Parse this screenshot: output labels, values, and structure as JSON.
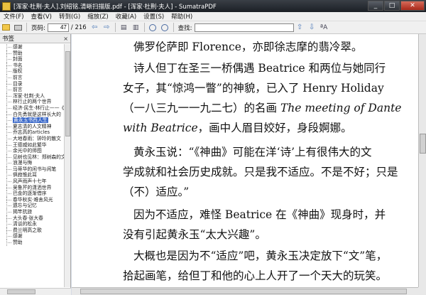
{
  "window": {
    "title": "[浑家·杜荆·夫人].刘绍铭.清晰扫描版.pdf - [浑家·杜荆·夫人] - SumatraPDF",
    "min": "_",
    "max": "□",
    "close": "✕"
  },
  "menu": [
    "文件(F)",
    "查看(V)",
    "转到(G)",
    "缩放(Z)",
    "收藏(A)",
    "设置(S)",
    "帮助(H)"
  ],
  "toolbar": {
    "page_label": "页码:",
    "page_value": "47",
    "page_total": "/ 216",
    "find_label": "查找:",
    "find_value": "",
    "case_label": "ªA"
  },
  "sidebar": {
    "title": "书签",
    "close": "×",
    "items": [
      "感谢",
      "赞助",
      "封面",
      "书名",
      "版权",
      "前言",
      "目录",
      "前言",
      "浑家·杜荆·夫人",
      "林行止的两个世界",
      "经济·民生·林行止——《",
      "白先勇就是这样长大的",
      "黄永玉书西人生",
      "夏志清的人文精神",
      "乔志高的articles",
      "大地春雨：钟玲的散文",
      "王德威如此繁华",
      "余光中的师图",
      "见树也见林：郑树森的文",
      "浪漫与悔",
      "马蒂华的闲书与闲笔",
      "俱寂惟此耳",
      "风声雨声十七年",
      "吴鲁芹的潇洒世界",
      "巴金的逐渐借序",
      "春华秋实·难舍风光",
      "遗忘与记忆",
      "揭竿抗旅",
      "大头春·张大春",
      "清谈的松永",
      "费兰明高之歌",
      "感谢",
      "赞助"
    ],
    "selected_index": 12
  },
  "document": {
    "paragraphs": [
      [
        "佛罗伦萨即 Florence，亦即徐志摩的翡冷翠。"
      ],
      [
        "诗人但丁在圣三一桥偶遇 Beatrice 和两位与她同行"
      ],
      [
        "女子，其“惊鸿一瞥”的神貌，已入了 Henry Holiday"
      ],
      [
        "（一八三九一一九二七）的名画 ",
        "The meeting of Dante",
        ""
      ],
      [
        "",
        "with Beatrice",
        "，画中人眉目姣好，身段婀娜。"
      ],
      [
        "黄永玉说：“《神曲》可能在洋‘诗’上有很伟大的文"
      ],
      [
        "学成就和社会历史成就。只是我不适应。不是不好；只是"
      ],
      [
        "（不）适应。”"
      ],
      [
        "因为不适应，难怪 Beatrice 在《神曲》现身时，并"
      ],
      [
        "没有引起黄永玉“太大兴趣”。"
      ],
      [
        "大概也是因为不“适应”吧，黄永玉决定放下“文”笔，"
      ],
      [
        "拾起画笔，给但丁和他的心上人开了一个天大的玩笑。"
      ]
    ]
  }
}
